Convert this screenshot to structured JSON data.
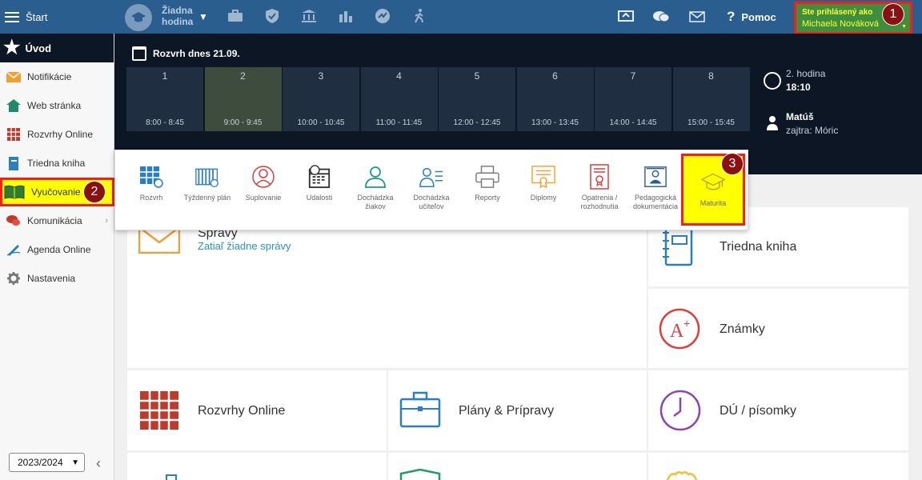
{
  "topbar": {
    "menu_label": "Štart",
    "class_line1": "Žiadna",
    "class_line2": "hodina",
    "help_label": "Pomoc",
    "user_label": "Ste prihlásený ako",
    "user_name": "Michaela Nováková",
    "badge_1": "1"
  },
  "sidebar": {
    "home_label": "Úvod",
    "items": [
      {
        "label": "Notifikácie"
      },
      {
        "label": "Web stránka"
      },
      {
        "label": "Rozvrhy Online"
      },
      {
        "label": "Triedna kniha"
      },
      {
        "label": "Vyučovanie"
      },
      {
        "label": "Komunikácia"
      },
      {
        "label": "Agenda Online"
      },
      {
        "label": "Nastavenia"
      }
    ],
    "badge_2": "2",
    "school_year": "2023/2024"
  },
  "schedule": {
    "title": "Rozvrh dnes 21.09.",
    "periods": [
      {
        "num": "1",
        "time": "8:00 - 8:45"
      },
      {
        "num": "2",
        "time": "9:00 - 9:45"
      },
      {
        "num": "3",
        "time": "10:00 - 10:45"
      },
      {
        "num": "4",
        "time": "11:00 - 11:45"
      },
      {
        "num": "5",
        "time": "12:00 - 12:45"
      },
      {
        "num": "6",
        "time": "13:00 - 13:45"
      },
      {
        "num": "7",
        "time": "14:00 - 14:45"
      },
      {
        "num": "8",
        "time": "15:00 - 15:45"
      }
    ],
    "current_period": "2. hodina",
    "current_time": "18:10",
    "duty_name": "Matúš",
    "tomorrow": "zajtra: Móric"
  },
  "dropdown": {
    "items": [
      {
        "label": "Rozvrh"
      },
      {
        "label": "Týždenný plán"
      },
      {
        "label": "Suplovanie"
      },
      {
        "label": "Udalosti"
      },
      {
        "label": "Dochádzka žiakov"
      },
      {
        "label": "Dochádzka učiteľov"
      },
      {
        "label": "Reporty"
      },
      {
        "label": "Diplomy"
      },
      {
        "label": "Opatrenia / rozhodnutia"
      },
      {
        "label": "Pedagogická dokumentácia"
      },
      {
        "label": "Maturita"
      }
    ],
    "badge_3": "3"
  },
  "tiles": {
    "messages_title": "Správy",
    "messages_sub": "Zatiaľ žiadne správy",
    "class_book": "Triedna kniha",
    "grades": "Známky",
    "schedules": "Rozvrhy Online",
    "plans": "Plány & Prípravy",
    "homework": "DÚ / písomky"
  },
  "colors": {
    "topbar": "#2a5e8f",
    "strip": "#0c1624",
    "highlight": "#ffff00",
    "annotation_border": "#ff1a1a",
    "badge": "#8b1111"
  }
}
